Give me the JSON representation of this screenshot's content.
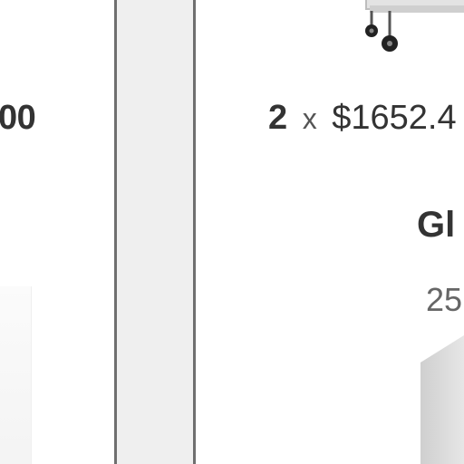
{
  "left_product": {
    "price_fragment": "00"
  },
  "right_product": {
    "quantity": "2",
    "times_symbol": "x",
    "unit_price": "$1652.4",
    "title_fragment": "Gl",
    "subtitle_fragment": "25"
  }
}
